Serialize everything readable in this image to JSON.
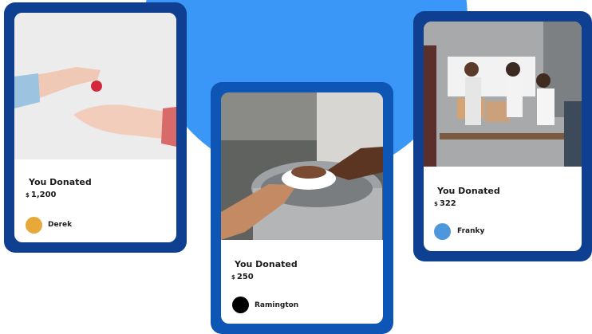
{
  "cards": [
    {
      "title": "You Donated",
      "currency": "$",
      "amount": "1,200",
      "name": "Derek",
      "avatar_color": "#e8a83a",
      "frame_color": "#0e3f91",
      "photo": "hands-giving-heart"
    },
    {
      "title": "You Donated",
      "currency": "$",
      "amount": "250",
      "name": "Ramington",
      "avatar_color": "#000000",
      "frame_color": "#0d56b5",
      "photo": "food-bowl-serving"
    },
    {
      "title": "You Donated",
      "currency": "$",
      "amount": "322",
      "name": "Franky",
      "avatar_color": "#4f97dc",
      "frame_color": "#0e3f91",
      "photo": "volunteers-aid-boxes"
    }
  ],
  "theme": {
    "background": "#ffffff",
    "blob_color": "#3b97f7"
  }
}
